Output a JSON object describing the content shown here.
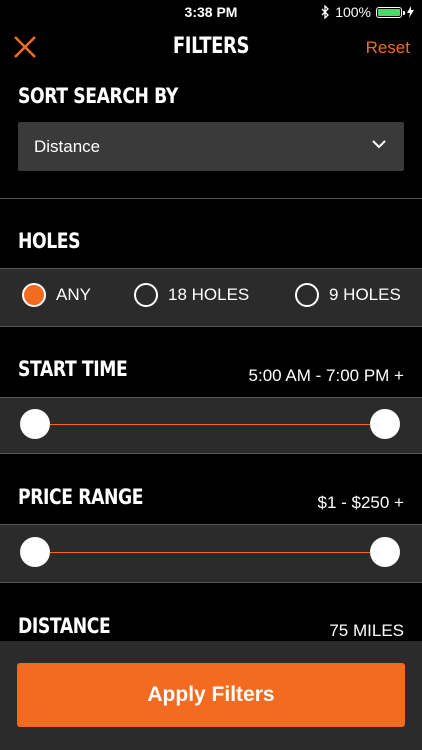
{
  "status_bar": {
    "time": "3:38 PM",
    "battery_text": "100%",
    "battery_level": 1.0,
    "bluetooth_icon": "bluetooth-icon",
    "charging_icon": "bolt-icon"
  },
  "nav": {
    "title": "FILTERS",
    "reset_label": "Reset",
    "close_icon": "close-x-icon"
  },
  "sort": {
    "title": "SORT SEARCH BY",
    "selected": "Distance",
    "chevron_icon": "chevron-down-icon"
  },
  "holes": {
    "title": "HOLES",
    "options": [
      {
        "label": "ANY",
        "selected": true
      },
      {
        "label": "18 HOLES",
        "selected": false
      },
      {
        "label": "9 HOLES",
        "selected": false
      }
    ]
  },
  "start_time": {
    "title": "START TIME",
    "value": "5:00 AM - 7:00 PM +",
    "range": [
      0,
      1
    ]
  },
  "price_range": {
    "title": "PRICE RANGE",
    "value": "$1 - $250 +",
    "range": [
      0,
      1
    ]
  },
  "distance": {
    "title": "DISTANCE",
    "value": "75 MILES"
  },
  "footer": {
    "apply_label": "Apply Filters"
  },
  "colors": {
    "accent": "#f26b21",
    "background": "#000000",
    "band": "#2b2b2b",
    "dropdown": "#3a3a3a",
    "battery": "#4cd964"
  }
}
